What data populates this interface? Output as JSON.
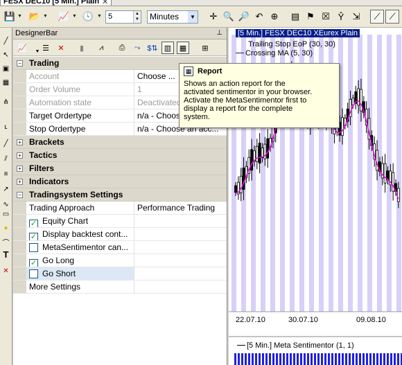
{
  "window_tab": {
    "title": "FESX DEC10 [5 Min.]  Plain"
  },
  "toolbar": {
    "period_value": "5",
    "period_unit": "Minutes"
  },
  "designer": {
    "title": "DesignerBar",
    "pin": " – ",
    "rows": [
      {
        "kind": "cat",
        "expander": "−",
        "name": "Trading"
      },
      {
        "kind": "prop",
        "name": "Account",
        "value": "Choose ...",
        "dim_name": true
      },
      {
        "kind": "prop",
        "name": "Order Volume",
        "value": "1",
        "dim": true
      },
      {
        "kind": "prop",
        "name": "Automation state",
        "value": "Deactivated",
        "dim": true
      },
      {
        "kind": "prop",
        "name": "Target Ordertype",
        "value": "n/a - Choose an acc..."
      },
      {
        "kind": "prop",
        "name": "Stop Ordertype",
        "value": "n/a - Choose an acc..."
      },
      {
        "kind": "cat",
        "expander": "+",
        "name": "Brackets"
      },
      {
        "kind": "cat",
        "expander": "+",
        "name": "Tactics"
      },
      {
        "kind": "cat",
        "expander": "+",
        "name": "Filters"
      },
      {
        "kind": "cat",
        "expander": "+",
        "name": "Indicators"
      },
      {
        "kind": "cat",
        "expander": "−",
        "name": "Tradingsystem Settings"
      },
      {
        "kind": "prop",
        "name": "Trading Approach",
        "value": "Performance Trading"
      },
      {
        "kind": "check",
        "name": "Equity Chart",
        "checked": true
      },
      {
        "kind": "check",
        "name": "Display backtest cont...",
        "checked": true
      },
      {
        "kind": "check",
        "name": "MetaSentimentor can...",
        "checked": false
      },
      {
        "kind": "check",
        "name": "Go Long",
        "checked": true
      },
      {
        "kind": "check",
        "name": "Go Short",
        "checked": false,
        "selected": true
      },
      {
        "kind": "prop",
        "name": "More Settings",
        "value": ""
      }
    ]
  },
  "tooltip": {
    "title": "Report",
    "lines": [
      "Shows an action report for the",
      "activated sentimentor in your browser.",
      "Activate the MetaSentimentor first to",
      "display a report for the complete",
      "system."
    ]
  },
  "chart": {
    "legend_main": "[5 Min.] FESX DEC10    XEurex Plain",
    "legend_trailing_stop": "Trailing Stop EoP  (30, 30)",
    "legend_ma": "Crossing MA  (5, 30)",
    "x_labels": [
      "22.07.10",
      "30.07.10",
      "09.08.10"
    ],
    "sub_legend": "[5 Min.] Meta Sentimentor  (1, 1)",
    "colors": {
      "band": "#d8d0f8",
      "ma": "#e010e0",
      "up": "#ffffff",
      "down": "#000000",
      "sub_bar": "#2020e0",
      "legend_bg": "#0a1f8a"
    }
  }
}
